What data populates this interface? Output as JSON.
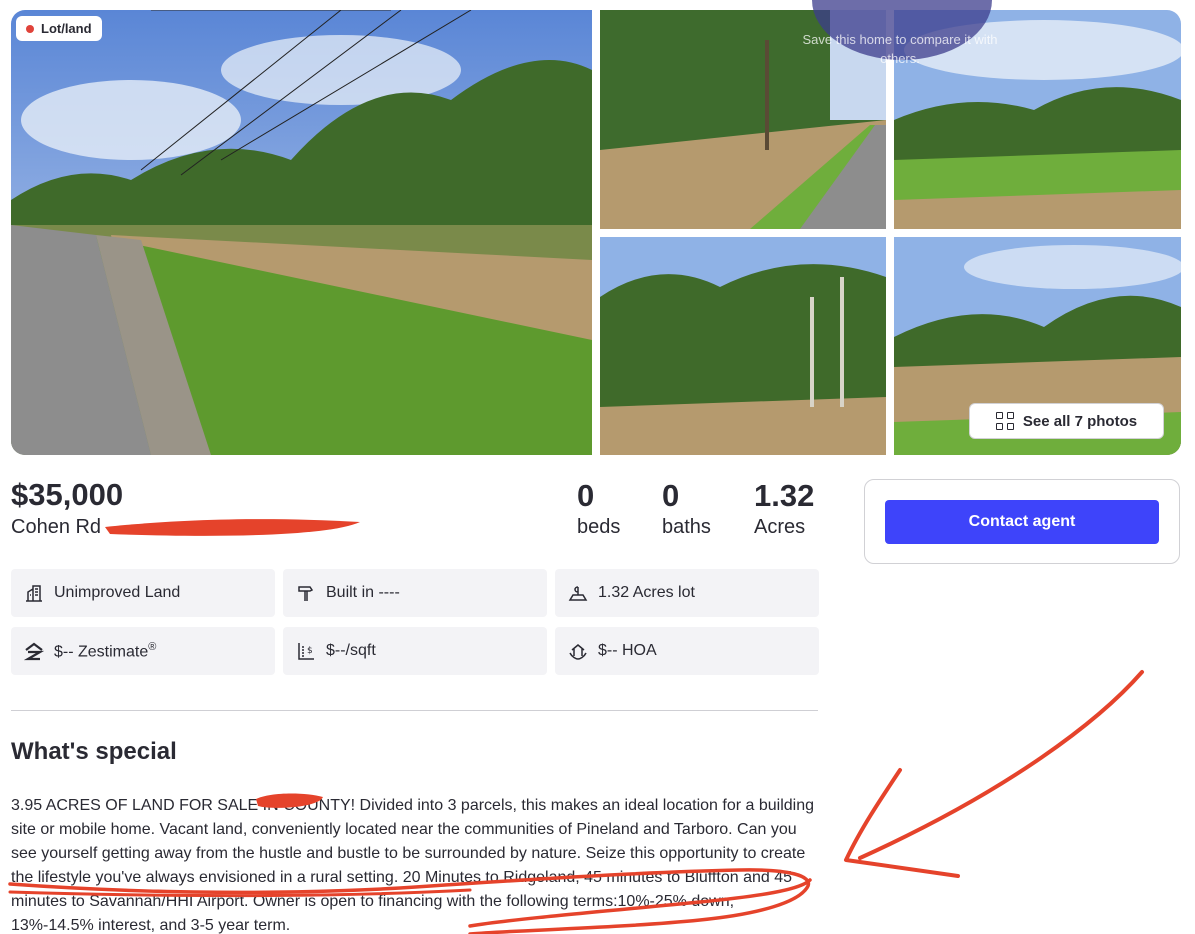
{
  "gallery": {
    "badge_label": "Lot/land",
    "save_tooltip": "Save this home to compare it with others.",
    "see_all_label": "See all 7 photos",
    "colors": {
      "sky": "#7fa6e0",
      "grass": "#6fae3c",
      "dry_grass": "#b59a6e",
      "road": "#8d8d8d"
    }
  },
  "listing": {
    "price": "$35,000",
    "address": "Cohen Rd",
    "beds_value": "0",
    "beds_label": "beds",
    "baths_value": "0",
    "baths_label": "baths",
    "acres_value": "1.32",
    "acres_label": "Acres"
  },
  "contact": {
    "button_label": "Contact agent",
    "button_color": "#3e44fa"
  },
  "facts": [
    {
      "icon": "land-icon",
      "text": "Unimproved Land"
    },
    {
      "icon": "hammer-icon",
      "text": "Built in ----"
    },
    {
      "icon": "lot-icon",
      "text": "1.32 Acres lot"
    },
    {
      "icon": "zestimate-icon",
      "text": "$-- Zestimate",
      "sup": "®"
    },
    {
      "icon": "price-sqft-icon",
      "text": "$--/sqft"
    },
    {
      "icon": "hoa-icon",
      "text": "$-- HOA"
    }
  ],
  "special": {
    "title": "What's special",
    "body": "3.95 ACRES OF LAND FOR SALE IN  COUNTY! Divided into 3 parcels, this makes an ideal location for a building site or mobile home. Vacant land, conveniently located near the communities of Pineland and Tarboro. Can you see yourself getting away from the hustle and bustle to be surrounded by nature. Seize this opportunity to create the lifestyle you've always envisioned in a rural setting. 20 Minutes to Ridgeland, 45 minutes to Bluffton and 45 minutes to Savannah/HHI Airport. Owner is open to financing with the following terms:10%-25% down, 13%-14.5% interest, and 3-5 year term."
  },
  "annotation_color": "#e5432b"
}
